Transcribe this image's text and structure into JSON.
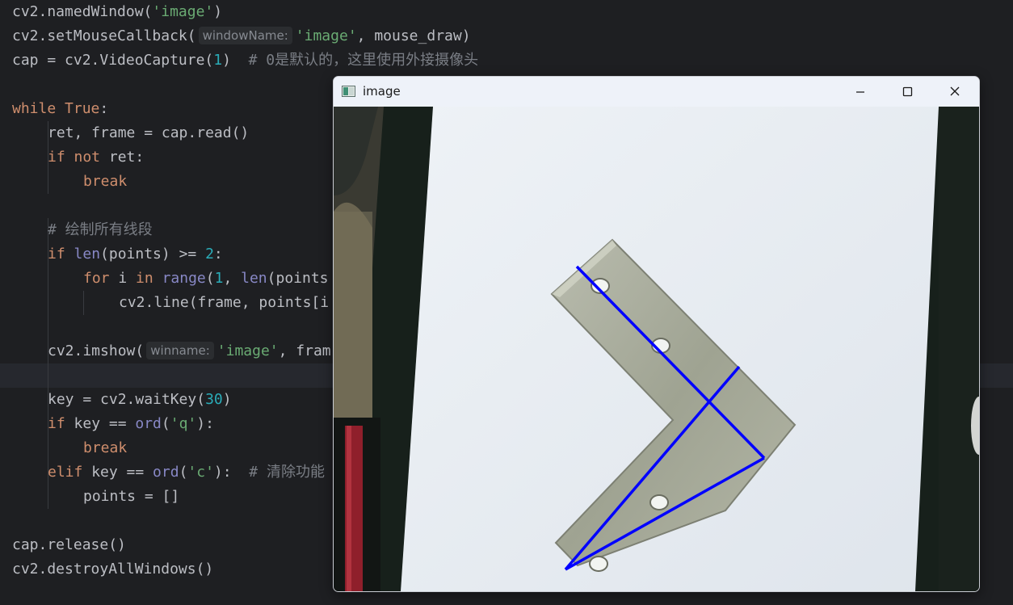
{
  "editor": {
    "code": {
      "named_window_pre": "cv2.namedWindow(",
      "named_window_arg": "'image'",
      "named_window_post": ")",
      "set_mouse_pre": "cv2.setMouseCallback(",
      "set_mouse_hint": "windowName:",
      "set_mouse_arg": "'image'",
      "set_mouse_post": ", mouse_draw)",
      "cap_pre": "cap = cv2.VideoCapture(",
      "cap_num": "1",
      "cap_post": ")  ",
      "cap_comment": "# 0是默认的，这里使用外接摄像头",
      "while_kw": "while ",
      "while_true": "True",
      "while_post": ":",
      "read_line": "ret, frame = cap.read()",
      "if_not_kw": "if not ",
      "if_not_post": "ret:",
      "break_kw": "break",
      "draw_comment": "# 绘制所有线段",
      "if_kw": "if ",
      "len_fn": "len",
      "if_len_mid": "(points) >= ",
      "if_len_num": "2",
      "if_len_post": ":",
      "for_kw": "for ",
      "for_var": "i ",
      "in_kw": "in ",
      "range_fn": "range",
      "for_open": "(",
      "for_num": "1",
      "for_sep": ", ",
      "for_len": "len",
      "for_post": "(points",
      "line_call": "cv2.line(frame, points[i",
      "imshow_pre": "cv2.imshow(",
      "imshow_hint": "winname:",
      "imshow_arg": "'image'",
      "imshow_post": ", fram",
      "wait_pre": "key = cv2.waitKey(",
      "wait_num": "30",
      "wait_post": ")",
      "if_key_kw": "if ",
      "if_key_mid": "key == ",
      "ord_fn": "ord",
      "if_key_open": "(",
      "if_key_str": "'q'",
      "if_key_post": "):",
      "elif_kw": "elif ",
      "elif_mid": "key == ",
      "elif_ord": "ord",
      "elif_open": "(",
      "elif_str": "'c'",
      "elif_post": "):  ",
      "clear_comment": "# 清除功能",
      "points_reset": "points = []",
      "release": "cap.release()",
      "destroy": "cv2.destroyAllWindows()"
    }
  },
  "window": {
    "title": "image",
    "icons": {
      "app": "window-app-icon",
      "minimize": "minimize-icon",
      "maximize": "maximize-icon",
      "close": "close-icon"
    },
    "drawn_lines_color": "#0000ff"
  },
  "colors": {
    "keyword": "#cf8e6d",
    "string": "#6aab73",
    "number": "#2aacb8",
    "builtin": "#8888c6",
    "comment": "#7a7e85"
  }
}
